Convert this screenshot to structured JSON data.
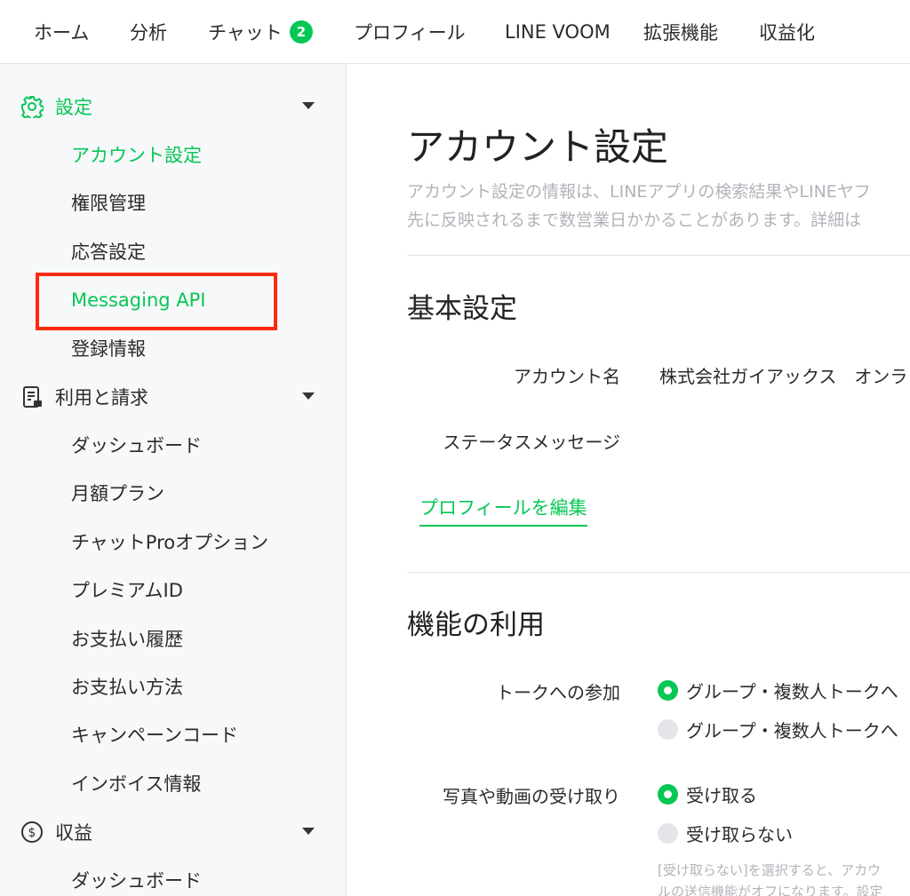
{
  "topnav": {
    "home": "ホーム",
    "analytics": "分析",
    "chat": "チャット",
    "chat_badge": "2",
    "profile": "プロフィール",
    "line_voom": "LINE VOOM",
    "extensions": "拡張機能",
    "monetization": "収益化"
  },
  "sidebar": {
    "settings": {
      "label": "設定",
      "items": [
        "アカウント設定",
        "権限管理",
        "応答設定",
        "Messaging API",
        "登録情報"
      ]
    },
    "billing": {
      "label": "利用と請求",
      "items": [
        "ダッシュボード",
        "月額プラン",
        "チャットProオプション",
        "プレミアムID",
        "お支払い履歴",
        "お支払い方法",
        "キャンペーンコード",
        "インボイス情報"
      ]
    },
    "revenue": {
      "label": "収益",
      "items": [
        "ダッシュボード"
      ]
    }
  },
  "main": {
    "title": "アカウント設定",
    "description_line1": "アカウント設定の情報は、LINEアプリの検索結果やLINEヤフ",
    "description_line2": "先に反映されるまで数営業日かかることがあります。詳細は",
    "basic": {
      "title": "基本設定",
      "account_name_label": "アカウント名",
      "account_name_value": "株式会社ガイアックス　オンラ",
      "status_message_label": "ステータスメッセージ",
      "edit_profile": "プロフィールを編集"
    },
    "features": {
      "title": "機能の利用",
      "talk_label": "トークへの参加",
      "talk_option1": "グループ・複数人トークへ",
      "talk_option2": "グループ・複数人トークへ",
      "media_label": "写真や動画の受け取り",
      "media_option1": "受け取る",
      "media_option2": "受け取らない",
      "note_line1": "[受け取らない]を選択すると、アカウ",
      "note_line2": "ルの送信機能がオフになります。設定"
    }
  },
  "colors": {
    "accent": "#06c755",
    "highlight": "#ff2a0d",
    "sidebar_bg": "#f7f8fa"
  }
}
